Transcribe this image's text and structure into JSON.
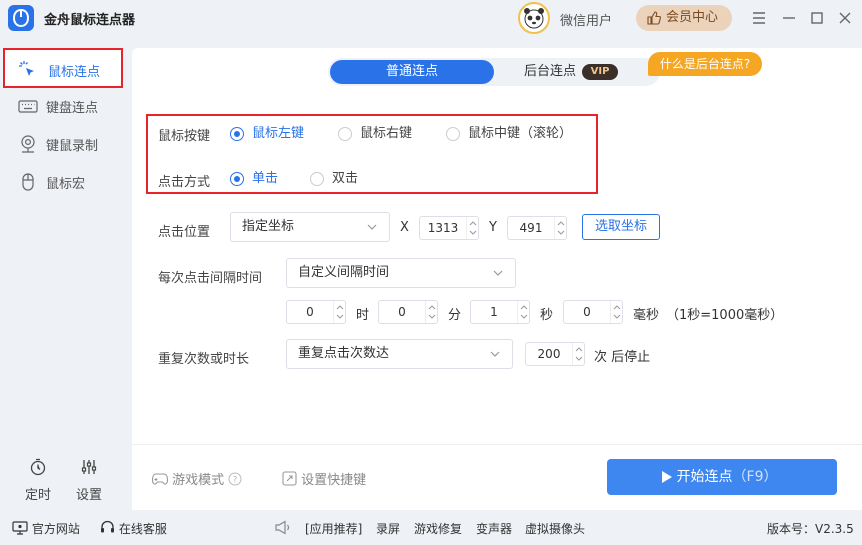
{
  "app": {
    "title": "金舟鼠标连点器"
  },
  "header": {
    "user_name": "微信用户",
    "vip_center": "会员中心"
  },
  "sidebar": {
    "items": [
      {
        "label": "鼠标连点",
        "icon": "cursor-click-icon",
        "active": true
      },
      {
        "label": "键盘连点",
        "icon": "keyboard-icon",
        "active": false
      },
      {
        "label": "键鼠录制",
        "icon": "record-icon",
        "active": false
      },
      {
        "label": "鼠标宏",
        "icon": "mouse-icon",
        "active": false
      }
    ],
    "timer_label": "定时",
    "settings_label": "设置"
  },
  "tabs": {
    "normal": "普通连点",
    "background": "后台连点",
    "vip_tag": "VIP",
    "what_is_bg": "什么是后台连点?"
  },
  "mouse_button": {
    "label": "鼠标按键",
    "options": [
      "鼠标左键",
      "鼠标右键",
      "鼠标中键（滚轮）"
    ],
    "selected": "鼠标左键"
  },
  "click_mode": {
    "label": "点击方式",
    "options": [
      "单击",
      "双击"
    ],
    "selected": "单击"
  },
  "click_position": {
    "label": "点击位置",
    "mode": "指定坐标",
    "x_label": "X",
    "x_value": "1313",
    "y_label": "Y",
    "y_value": "491",
    "pick_button": "选取坐标"
  },
  "interval": {
    "label": "每次点击间隔时间",
    "mode": "自定义间隔时间",
    "hours": "0",
    "hours_unit": "时",
    "minutes": "0",
    "minutes_unit": "分",
    "seconds": "1",
    "seconds_unit": "秒",
    "millis": "0",
    "millis_unit": "毫秒",
    "note": "（1秒=1000毫秒）"
  },
  "repeat": {
    "label": "重复次数或时长",
    "mode": "重复点击次数达",
    "count": "200",
    "suffix": "次 后停止"
  },
  "actions": {
    "game_mode": "游戏模式",
    "shortcut": "设置快捷键",
    "start": "开始连点",
    "start_key": "（F9）"
  },
  "status": {
    "website": "官方网站",
    "support": "在线客服",
    "recommend": "[应用推荐]",
    "apps": [
      "录屏",
      "游戏修复",
      "变声器",
      "虚拟摄像头"
    ],
    "version": "版本号：V2.3.5"
  },
  "colors": {
    "accent": "#2a72e8",
    "highlight": "#e8232a",
    "vip_orange": "#f5a623"
  }
}
